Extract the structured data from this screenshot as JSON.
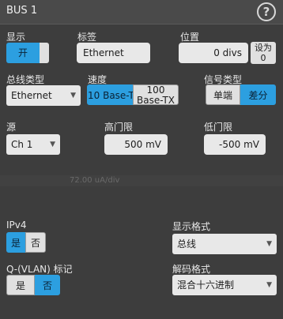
{
  "title": "BUS 1",
  "help_icon": "?",
  "display": {
    "label": "显示",
    "on": "开"
  },
  "label_field": {
    "label": "标签",
    "value": "Ethernet"
  },
  "position": {
    "label": "位置",
    "value": "0 divs",
    "set_to_zero": "设为\n0"
  },
  "bus_type": {
    "label": "总线类型",
    "value": "Ethernet"
  },
  "speed": {
    "label": "速度",
    "opt1": "10 Base-T",
    "opt2": "100 Base-TX"
  },
  "signal_type": {
    "label": "信号类型",
    "opt1": "单端",
    "opt2": "差分"
  },
  "source": {
    "label": "源",
    "value": "Ch 1"
  },
  "high_threshold": {
    "label": "高门限",
    "value": "500 mV"
  },
  "low_threshold": {
    "label": "低门限",
    "value": "-500 mV"
  },
  "ipv4": {
    "label": "IPv4",
    "yes": "是",
    "no": "否"
  },
  "display_format": {
    "label": "显示格式",
    "value": "总线"
  },
  "qvlan": {
    "label": "Q-(VLAN) 标记",
    "yes": "是",
    "no": "否"
  },
  "decode_format": {
    "label": "解码格式",
    "value": "混合十六进制"
  },
  "background_ghost": {
    "readout": "72.00 uA/div"
  }
}
